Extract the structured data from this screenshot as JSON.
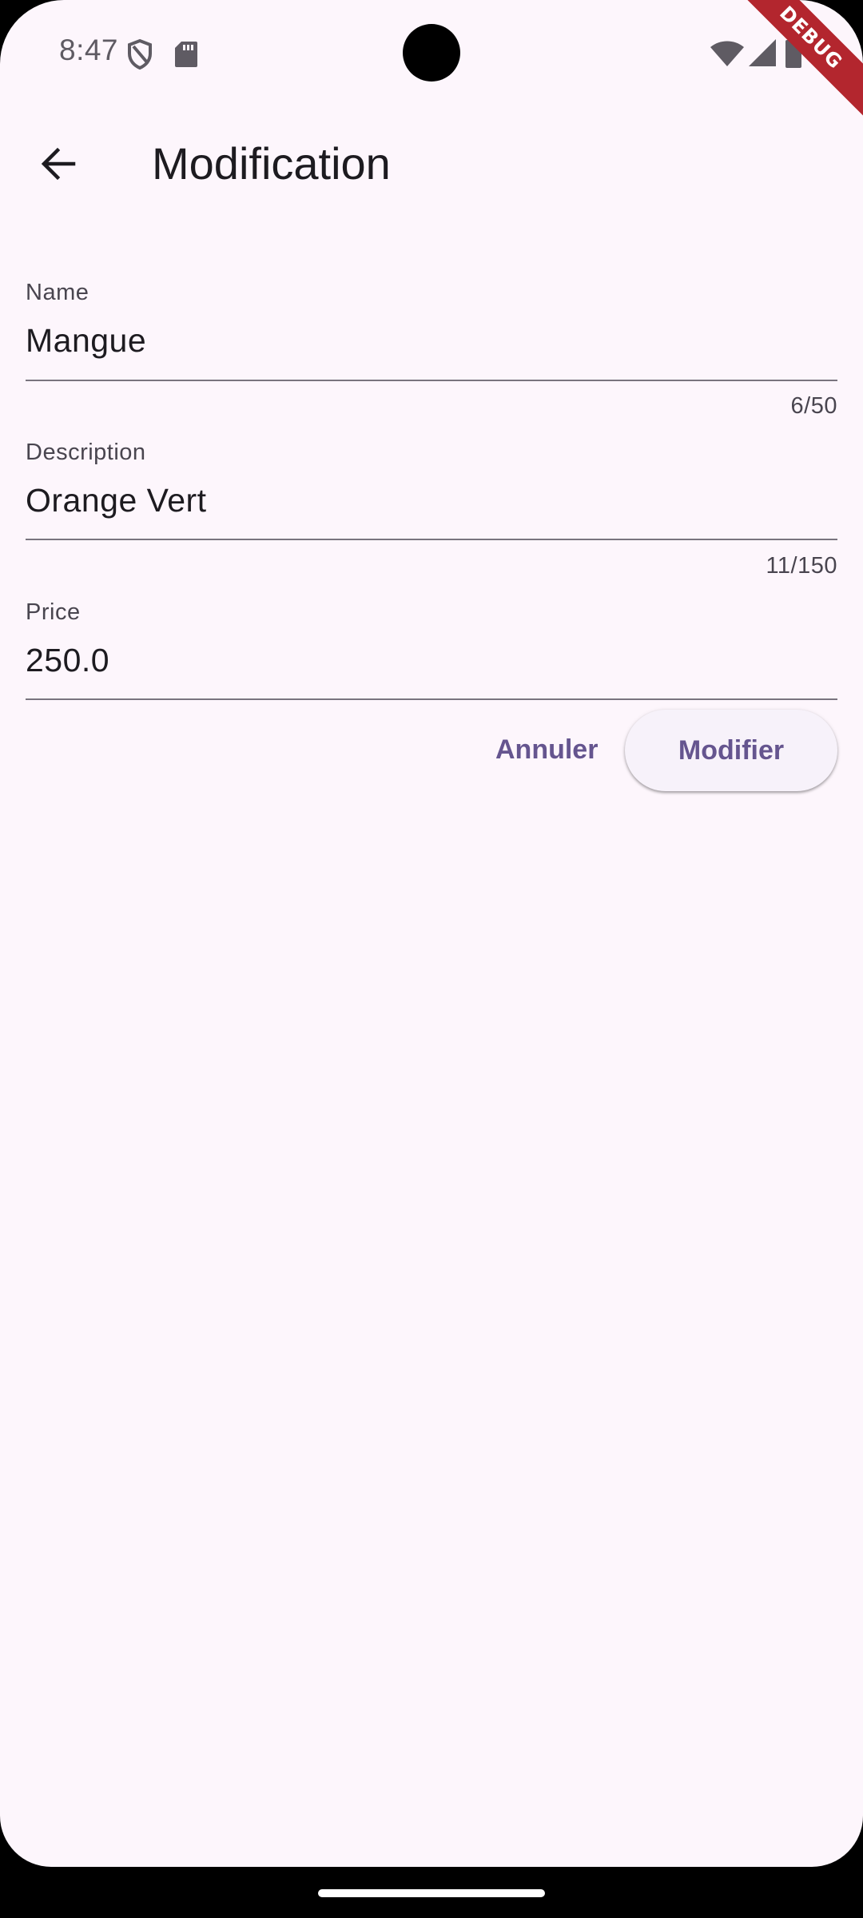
{
  "status_bar": {
    "time": "8:47",
    "icons": [
      "shield-icon",
      "sd-card-icon",
      "wifi-icon",
      "cellular-signal-icon",
      "battery-icon"
    ]
  },
  "debug_banner": "DEBUG",
  "app_bar": {
    "title": "Modification",
    "back_icon": "arrow-back-icon"
  },
  "form": {
    "name": {
      "label": "Name",
      "value": "Mangue",
      "counter": "6/50"
    },
    "description": {
      "label": "Description",
      "value": "Orange Vert",
      "counter": "11/150"
    },
    "price": {
      "label": "Price",
      "value": "250.0"
    }
  },
  "actions": {
    "cancel_label": "Annuler",
    "submit_label": "Modifier"
  },
  "colors": {
    "background": "#fdf6fc",
    "primary": "#65558f",
    "on_surface": "#1d1b20",
    "on_surface_variant": "#49454f",
    "outline": "#79747e",
    "debug_banner": "#b3262e"
  }
}
